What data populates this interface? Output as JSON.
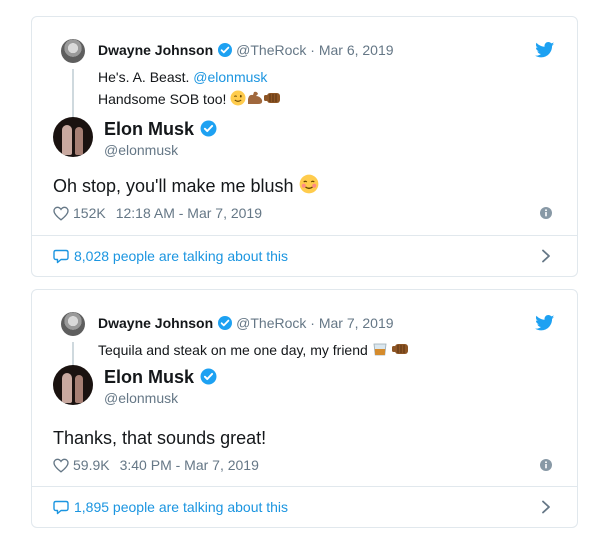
{
  "tweets": [
    {
      "parent": {
        "name": "Dwayne Johnson",
        "handle": "@TheRock",
        "separator": "·",
        "date": "Mar 6, 2019",
        "line1": "He's. A. Beast. ",
        "mention": "@elonmusk",
        "line2": "Handsome SOB too! ",
        "emojis": [
          "winking-face-icon",
          "flexed-biceps-icon",
          "oncoming-fist-icon"
        ]
      },
      "main": {
        "name": "Elon Musk",
        "handle": "@elonmusk",
        "text": "Oh stop, you'll make me blush ",
        "emojis": [
          "smiling-blushing-face-icon"
        ],
        "likes": "152K",
        "timestamp": "12:18 AM - Mar 7, 2019"
      },
      "talking": "8,028 people are talking about this"
    },
    {
      "parent": {
        "name": "Dwayne Johnson",
        "handle": "@TheRock",
        "separator": "·",
        "date": "Mar 7, 2019",
        "line1": "Tequila and steak on me one day, my friend ",
        "emojis": [
          "tumbler-glass-icon",
          "oncoming-fist-icon"
        ]
      },
      "main": {
        "name": "Elon Musk",
        "handle": "@elonmusk",
        "text": "Thanks, that sounds great!",
        "likes": "59.9K",
        "timestamp": "3:40 PM - Mar 7, 2019"
      },
      "talking": "1,895 people are talking about this"
    }
  ],
  "colors": {
    "twitter_blue": "#1da1f2",
    "link": "#1b95e0",
    "muted": "#657786",
    "border": "#e1e8ed"
  }
}
